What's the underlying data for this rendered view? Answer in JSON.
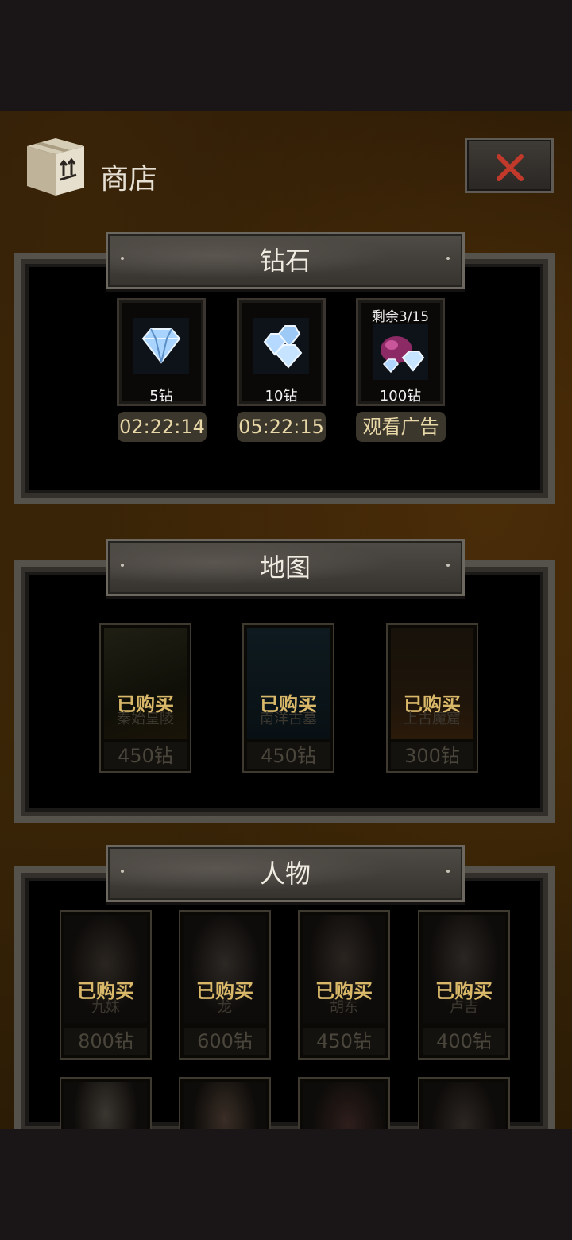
{
  "header": {
    "title": "商店",
    "icon": "cardboard-box-icon",
    "close_icon": "close-icon",
    "accent": "#c0392b"
  },
  "diamond_section": {
    "title": "钻石",
    "items": [
      {
        "amount": "5钻",
        "timer": "02:22:14"
      },
      {
        "amount": "10钻",
        "timer": "05:22:15"
      },
      {
        "amount": "100钻",
        "remaining": "剩余3/15",
        "action": "观看广告"
      }
    ]
  },
  "map_section": {
    "title": "地图",
    "items": [
      {
        "status": "已购买",
        "name": "秦始皇陵",
        "price": "450钻"
      },
      {
        "status": "已购买",
        "name": "南洋古墓",
        "price": "450钻"
      },
      {
        "status": "已购买",
        "name": "上古魔窟",
        "price": "300钻"
      }
    ]
  },
  "character_section": {
    "title": "人物",
    "items": [
      {
        "status": "已购买",
        "name": "九妹",
        "price": "800钻"
      },
      {
        "status": "已购买",
        "name": "龙",
        "price": "600钻"
      },
      {
        "status": "已购买",
        "name": "胡东",
        "price": "450钻"
      },
      {
        "status": "已购买",
        "name": "卢吉",
        "price": "400钻"
      }
    ]
  }
}
